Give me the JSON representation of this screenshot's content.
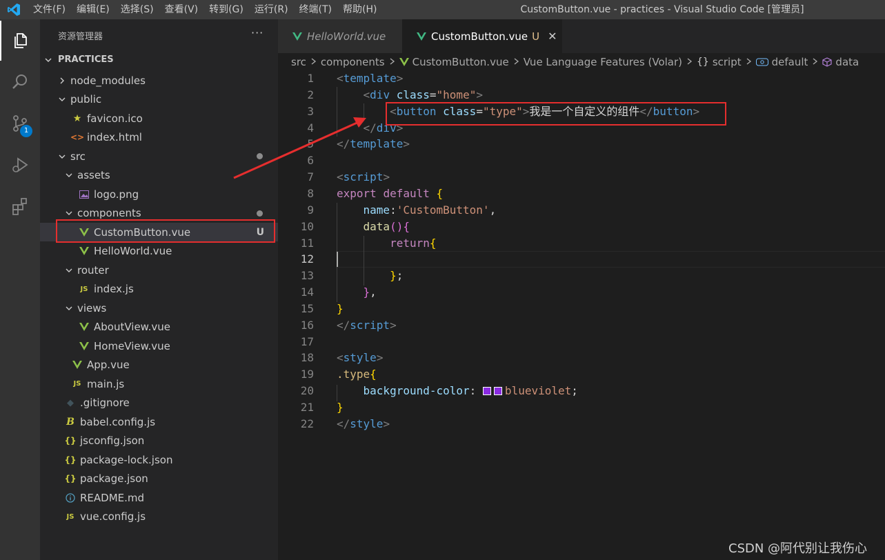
{
  "menu": [
    "文件(F)",
    "编辑(E)",
    "选择(S)",
    "查看(V)",
    "转到(G)",
    "运行(R)",
    "终端(T)",
    "帮助(H)"
  ],
  "window_title": "CustomButton.vue - practices - Visual Studio Code [管理员]",
  "activity": {
    "scm_badge": "1"
  },
  "sidebar": {
    "title": "资源管理器",
    "more": "···",
    "root": "PRACTICES",
    "tree": [
      {
        "label": "node_modules",
        "indent": 0,
        "folder": true,
        "open": false,
        "icon": ""
      },
      {
        "label": "public",
        "indent": 0,
        "folder": true,
        "open": true,
        "icon": ""
      },
      {
        "label": "favicon.ico",
        "indent": 1,
        "icon": "star"
      },
      {
        "label": "index.html",
        "indent": 1,
        "icon": "html"
      },
      {
        "label": "src",
        "indent": 0,
        "folder": true,
        "open": true,
        "icon": "",
        "dot": true
      },
      {
        "label": "assets",
        "indent": 1,
        "folder": true,
        "open": true,
        "icon": ""
      },
      {
        "label": "logo.png",
        "indent": 2,
        "icon": "image"
      },
      {
        "label": "components",
        "indent": 1,
        "folder": true,
        "open": true,
        "icon": "",
        "dot": true
      },
      {
        "label": "CustomButton.vue",
        "indent": 2,
        "icon": "vue",
        "selected": true,
        "badge": "U"
      },
      {
        "label": "HelloWorld.vue",
        "indent": 2,
        "icon": "vue"
      },
      {
        "label": "router",
        "indent": 1,
        "folder": true,
        "open": true,
        "icon": ""
      },
      {
        "label": "index.js",
        "indent": 2,
        "icon": "js"
      },
      {
        "label": "views",
        "indent": 1,
        "folder": true,
        "open": true,
        "icon": ""
      },
      {
        "label": "AboutView.vue",
        "indent": 2,
        "icon": "vue"
      },
      {
        "label": "HomeView.vue",
        "indent": 2,
        "icon": "vue"
      },
      {
        "label": "App.vue",
        "indent": 1,
        "icon": "vue"
      },
      {
        "label": "main.js",
        "indent": 1,
        "icon": "js"
      },
      {
        "label": ".gitignore",
        "indent": 0,
        "icon": "git"
      },
      {
        "label": "babel.config.js",
        "indent": 0,
        "icon": "babel"
      },
      {
        "label": "jsconfig.json",
        "indent": 0,
        "icon": "json"
      },
      {
        "label": "package-lock.json",
        "indent": 0,
        "icon": "json"
      },
      {
        "label": "package.json",
        "indent": 0,
        "icon": "json"
      },
      {
        "label": "README.md",
        "indent": 0,
        "icon": "info"
      },
      {
        "label": "vue.config.js",
        "indent": 0,
        "icon": "js"
      }
    ]
  },
  "tabs": [
    {
      "label": "HelloWorld.vue",
      "active": false
    },
    {
      "label": "CustomButton.vue",
      "active": true,
      "badge": "U",
      "close": "✕"
    }
  ],
  "breadcrumbs": [
    {
      "label": "src",
      "icon": ""
    },
    {
      "label": "components",
      "icon": ""
    },
    {
      "label": "CustomButton.vue",
      "icon": "vue"
    },
    {
      "label": "Vue Language Features (Volar)",
      "icon": ""
    },
    {
      "label": "script",
      "icon": "braces"
    },
    {
      "label": "default",
      "icon": "module"
    },
    {
      "label": "data",
      "icon": "cube"
    }
  ],
  "code": [
    {
      "n": "1",
      "t": [
        [
          "t-punc",
          "<"
        ],
        [
          "t-tag",
          "template"
        ],
        [
          "t-punc",
          ">"
        ]
      ]
    },
    {
      "n": "2",
      "t": [
        [
          "t-text",
          "    "
        ],
        [
          "t-punc",
          "<"
        ],
        [
          "t-tag",
          "div"
        ],
        [
          "t-text",
          " "
        ],
        [
          "t-attr",
          "class"
        ],
        [
          "t-eq",
          "="
        ],
        [
          "t-str",
          "\"home\""
        ],
        [
          "t-punc",
          ">"
        ]
      ]
    },
    {
      "n": "3",
      "t": [
        [
          "t-text",
          "        "
        ],
        [
          "t-punc",
          "<"
        ],
        [
          "t-tag",
          "button"
        ],
        [
          "t-text",
          " "
        ],
        [
          "t-attr",
          "class"
        ],
        [
          "t-eq",
          "="
        ],
        [
          "t-str",
          "\"type\""
        ],
        [
          "t-punc",
          ">"
        ],
        [
          "t-text",
          "我是一个自定义的组件"
        ],
        [
          "t-punc",
          "</"
        ],
        [
          "t-tag",
          "button"
        ],
        [
          "t-punc",
          ">"
        ]
      ]
    },
    {
      "n": "4",
      "t": [
        [
          "t-text",
          "    "
        ],
        [
          "t-punc",
          "</"
        ],
        [
          "t-tag",
          "div"
        ],
        [
          "t-punc",
          ">"
        ]
      ]
    },
    {
      "n": "5",
      "t": [
        [
          "t-punc",
          "</"
        ],
        [
          "t-tag",
          "template"
        ],
        [
          "t-punc",
          ">"
        ]
      ]
    },
    {
      "n": "6",
      "t": []
    },
    {
      "n": "7",
      "t": [
        [
          "t-punc",
          "<"
        ],
        [
          "t-tag",
          "script"
        ],
        [
          "t-punc",
          ">"
        ]
      ]
    },
    {
      "n": "8",
      "t": [
        [
          "t-kw",
          "export"
        ],
        [
          "t-text",
          " "
        ],
        [
          "t-kw",
          "default"
        ],
        [
          "t-text",
          " "
        ],
        [
          "t-brace",
          "{"
        ]
      ]
    },
    {
      "n": "9",
      "t": [
        [
          "t-text",
          "    "
        ],
        [
          "t-prop",
          "name"
        ],
        [
          "t-text",
          ":"
        ],
        [
          "t-str",
          "'CustomButton'"
        ],
        [
          "t-text",
          ","
        ]
      ]
    },
    {
      "n": "10",
      "t": [
        [
          "t-text",
          "    "
        ],
        [
          "t-fn",
          "data"
        ],
        [
          "t-paren",
          "(){"
        ]
      ]
    },
    {
      "n": "11",
      "t": [
        [
          "t-text",
          "        "
        ],
        [
          "t-kw",
          "return"
        ],
        [
          "t-brace",
          "{"
        ]
      ]
    },
    {
      "n": "12",
      "t": []
    },
    {
      "n": "13",
      "t": [
        [
          "t-text",
          "        "
        ],
        [
          "t-brace",
          "}"
        ],
        [
          "t-text",
          ";"
        ]
      ]
    },
    {
      "n": "14",
      "t": [
        [
          "t-text",
          "    "
        ],
        [
          "t-paren",
          "}"
        ],
        [
          "t-text",
          ","
        ]
      ]
    },
    {
      "n": "15",
      "t": [
        [
          "t-brace",
          "}"
        ]
      ]
    },
    {
      "n": "16",
      "t": [
        [
          "t-punc",
          "</"
        ],
        [
          "t-tag",
          "script"
        ],
        [
          "t-punc",
          ">"
        ]
      ]
    },
    {
      "n": "17",
      "t": []
    },
    {
      "n": "18",
      "t": [
        [
          "t-punc",
          "<"
        ],
        [
          "t-tag",
          "style"
        ],
        [
          "t-punc",
          ">"
        ]
      ]
    },
    {
      "n": "19",
      "t": [
        [
          "t-sel",
          ".type"
        ],
        [
          "t-brace",
          "{"
        ]
      ]
    },
    {
      "n": "20",
      "t": [
        [
          "t-text",
          "    "
        ],
        [
          "t-prop",
          "background-color"
        ],
        [
          "t-text",
          ": "
        ],
        [
          "swatch",
          ""
        ],
        [
          "swatch",
          ""
        ],
        [
          "t-str",
          "blueviolet"
        ],
        [
          "t-text",
          ";"
        ]
      ]
    },
    {
      "n": "21",
      "t": [
        [
          "t-brace",
          "}"
        ]
      ]
    },
    {
      "n": "22",
      "t": [
        [
          "t-punc",
          "</"
        ],
        [
          "t-tag",
          "style"
        ],
        [
          "t-punc",
          ">"
        ]
      ]
    }
  ],
  "current_line": "12",
  "colors": {
    "highlight_box": "#e62e2e",
    "swatch": "#8a2be2",
    "accent": "#007acc"
  },
  "watermark": "CSDN @阿代别让我伤心"
}
